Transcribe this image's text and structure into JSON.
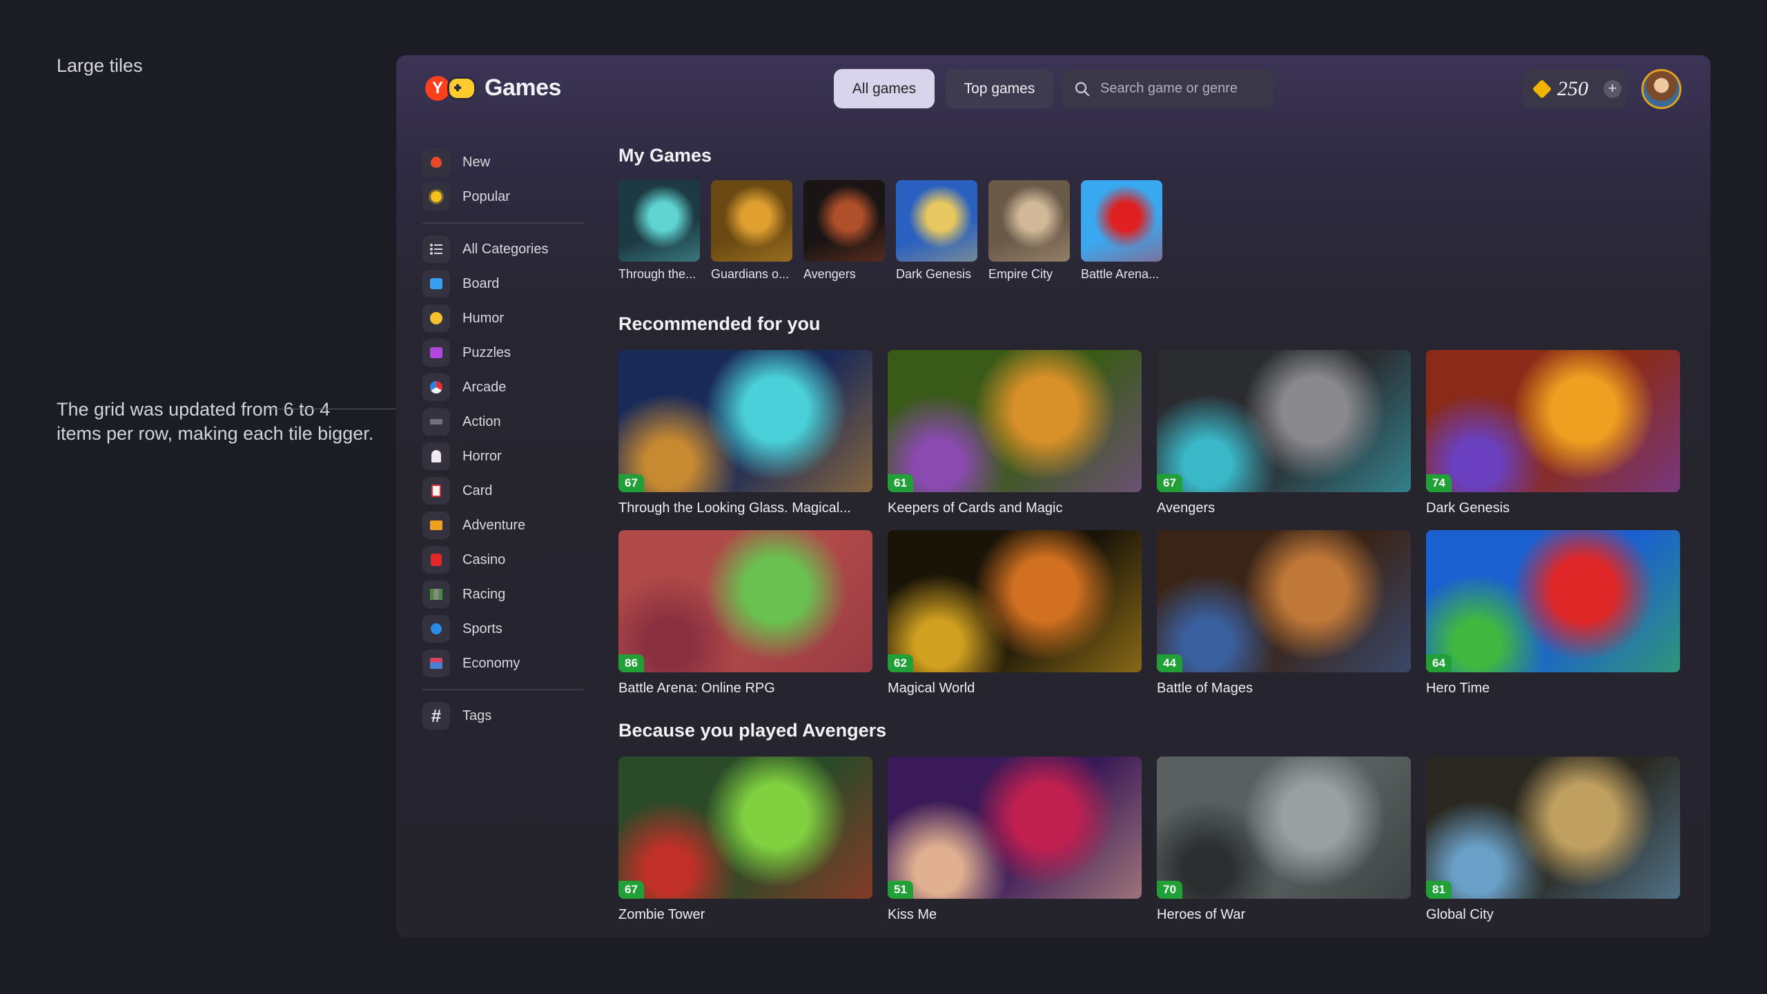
{
  "canvas": {
    "title": "Large tiles",
    "annotation": "The grid was updated from 6 to 4 items per row, making each tile bigger."
  },
  "header": {
    "logo_text": "Games",
    "tabs": [
      {
        "label": "All games",
        "active": true
      },
      {
        "label": "Top games",
        "active": false
      }
    ],
    "search": {
      "placeholder": "Search game or genre",
      "icon": "search-icon"
    },
    "coins": {
      "value": "250",
      "icon": "coin-icon",
      "add_icon": "plus-icon"
    },
    "accent": "#d8d4ec"
  },
  "sidebar": {
    "primary": [
      {
        "label": "New",
        "icon": "fire-icon"
      },
      {
        "label": "Popular",
        "icon": "sun-icon"
      }
    ],
    "categories": [
      {
        "label": "All Categories",
        "icon": "list-icon"
      },
      {
        "label": "Board",
        "icon": "board-icon"
      },
      {
        "label": "Humor",
        "icon": "smile-icon"
      },
      {
        "label": "Puzzles",
        "icon": "puzzle-icon"
      },
      {
        "label": "Arcade",
        "icon": "ball-icon"
      },
      {
        "label": "Action",
        "icon": "gun-icon"
      },
      {
        "label": "Horror",
        "icon": "ghost-icon"
      },
      {
        "label": "Card",
        "icon": "cards-icon"
      },
      {
        "label": "Adventure",
        "icon": "map-icon"
      },
      {
        "label": "Casino",
        "icon": "slot-icon"
      },
      {
        "label": "Racing",
        "icon": "road-icon"
      },
      {
        "label": "Sports",
        "icon": "racket-icon"
      },
      {
        "label": "Economy",
        "icon": "shop-icon"
      }
    ],
    "tags": {
      "label": "Tags",
      "icon": "hash-icon"
    }
  },
  "my_games": {
    "title": "My Games",
    "items": [
      {
        "label": "Through the...",
        "colors": [
          "#1d3a44",
          "#5fd4d0"
        ]
      },
      {
        "label": "Guardians o...",
        "colors": [
          "#6a4a12",
          "#e0a030"
        ]
      },
      {
        "label": "Avengers",
        "colors": [
          "#1a1414",
          "#b0502a"
        ]
      },
      {
        "label": "Dark Genesis",
        "colors": [
          "#2a60c0",
          "#e8c860"
        ]
      },
      {
        "label": "Empire City",
        "colors": [
          "#6a5a48",
          "#d0b898"
        ]
      },
      {
        "label": "Battle Arena...",
        "colors": [
          "#3aa8f0",
          "#e02020"
        ]
      }
    ]
  },
  "recommended": {
    "title": "Recommended for you",
    "items": [
      {
        "label": "Through the Looking Glass. Magical...",
        "rating": "67",
        "colors": [
          "#1a2a58",
          "#4ad0d8",
          "#c88a30"
        ]
      },
      {
        "label": "Keepers of Cards and Magic",
        "rating": "61",
        "colors": [
          "#3a5a18",
          "#d89028",
          "#8a4ab0"
        ]
      },
      {
        "label": "Avengers",
        "rating": "67",
        "colors": [
          "#2a2c30",
          "#8a8a8e",
          "#3ab8c8"
        ]
      },
      {
        "label": "Dark Genesis",
        "rating": "74",
        "colors": [
          "#8a2a18",
          "#f0a020",
          "#6a40c0"
        ]
      },
      {
        "label": "Battle Arena: Online RPG",
        "rating": "86",
        "colors": [
          "#b04a48",
          "#6ac050",
          "#8a3040"
        ]
      },
      {
        "label": "Magical World",
        "rating": "62",
        "colors": [
          "#1a1408",
          "#d07020",
          "#d0a020"
        ]
      },
      {
        "label": "Battle of Mages",
        "rating": "44",
        "colors": [
          "#3a2418",
          "#c07838",
          "#3a60a0"
        ]
      },
      {
        "label": "Hero Time",
        "rating": "64",
        "colors": [
          "#1a60d0",
          "#e02828",
          "#40b840"
        ]
      }
    ]
  },
  "because_played": {
    "title": "Because you played Avengers",
    "items": [
      {
        "label": "Zombie Tower",
        "rating": "67",
        "colors": [
          "#2a4a28",
          "#80d040",
          "#c03028"
        ]
      },
      {
        "label": "Kiss Me",
        "rating": "51",
        "colors": [
          "#3a1a58",
          "#c02050",
          "#e0b090"
        ]
      },
      {
        "label": "Heroes of War",
        "rating": "70",
        "colors": [
          "#5a6060",
          "#9aa0a0",
          "#2a2e2e"
        ]
      },
      {
        "label": "Global City",
        "rating": "81",
        "colors": [
          "#2a2820",
          "#c0a060",
          "#6aa0c8"
        ]
      }
    ]
  }
}
